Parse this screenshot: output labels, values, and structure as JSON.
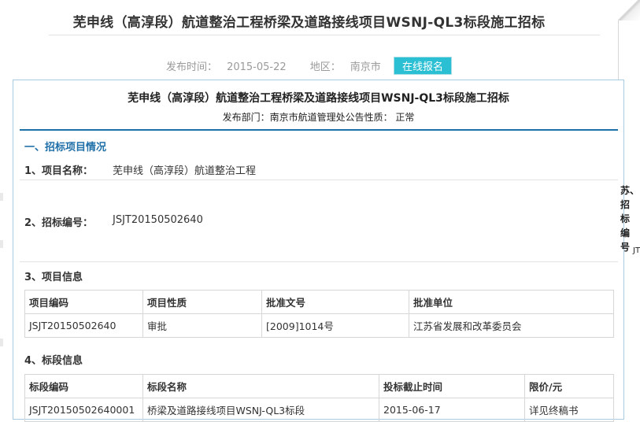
{
  "page": {
    "title": "芜申线（高淳段）航道整治工程桥梁及道路接线项目WSNJ-QL3标段施工招标",
    "publish_label": "发布时间：",
    "publish_date": "2015-05-22",
    "region_label": "地区：",
    "region": "南京市",
    "signup_button": "在线报名"
  },
  "notice": {
    "title": "芜申线（高淳段）航道整治工程桥梁及道路接线项目WSNJ-QL3标段施工招标",
    "dept_line": "发布部门：南京市航道管理处公告性质：  正常",
    "section1": "一、招标项目情况",
    "item1_label": "1、项目名称：",
    "item1_value": "芜申线（高淳段）航道整治工程",
    "item2_label": "2、招标编号：",
    "item2_value": "JSJT20150502640",
    "section3": "3、项目信息",
    "section4": "4、标段信息"
  },
  "project_table": {
    "headers": [
      "项目编码",
      "项目性质",
      "批准文号",
      "批准单位"
    ],
    "row": [
      "JSJT20150502640",
      "审批",
      "[2009]1014号",
      "江苏省发展和改革委员会"
    ]
  },
  "lot_table": {
    "headers": [
      "标段编码",
      "标段名称",
      "投标截止时间",
      "限价/元"
    ],
    "row": [
      "JSJT20150502640001",
      "桥梁及道路接线项目WSNJ-QL3标段",
      "2015-06-17",
      "详见终稿书"
    ]
  },
  "side": {
    "text": "苏、招标编号",
    "suffix": "JT"
  }
}
